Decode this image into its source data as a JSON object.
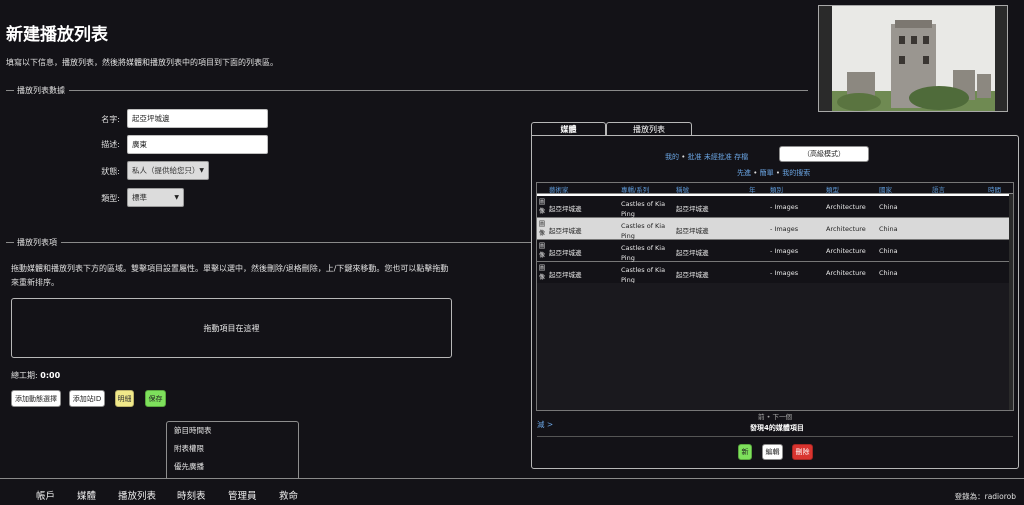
{
  "page": {
    "title": "新建播放列表",
    "intro": "填寫以下信息，播放列表，然後將媒體和播放列表中的項目到下面的列表區。"
  },
  "playlist_data": {
    "legend": "播放列表數據",
    "name_label": "名字:",
    "name_value": "起亞坪城邊",
    "desc_label": "描述:",
    "desc_value": "廣東",
    "status_label": "狀態:",
    "status_value": "私人（提供給您只）",
    "type_label": "類型:",
    "type_value": "標準"
  },
  "playlist_items": {
    "legend": "播放列表項",
    "help_text": "拖動媒體和播放列表下方的區域。雙擊項目設置屬性。單擊以選中，然後刪除/退格刪除，上/下鍵來移動。您也可以點擊拖動來重新排序。",
    "drop_zone": "拖動項目在這裡",
    "total_label": "總工期:",
    "total_value": "0:00"
  },
  "actions": {
    "add_dynamic": "添加動態選擇",
    "add_station_id": "添加站ID",
    "details": "明細",
    "save": "保存"
  },
  "dropdown_menu": [
    "節目時間表",
    "附表權限",
    "優先廣播"
  ],
  "tabs": {
    "media": "媒體",
    "playlists": "播放列表"
  },
  "media_panel": {
    "filter_mine": "我的",
    "filter_approved": "批准",
    "filter_unapproved": "未經批准",
    "filter_archive": "存檔",
    "sep": "•",
    "advanced_mode": "（高級模式）",
    "search_advanced": "先進",
    "search_simple": "簡單",
    "search_mine": "我的搜索",
    "columns": [
      "藝術家",
      "專輯/系列",
      "稱號",
      "年",
      "類別",
      "類型",
      "國家",
      "語言",
      "時間"
    ],
    "rows": [
      {
        "type": "圖像",
        "artist": "起亞坪城邊",
        "album": "Castles of Kia Ping",
        "title": "起亞坪城邊",
        "year": "",
        "category": "- Images",
        "genre": "Architecture",
        "country": "China"
      },
      {
        "type": "圖像",
        "artist": "起亞坪城邊",
        "album": "Castles of Kia Ping",
        "title": "起亞坪城邊",
        "year": "",
        "category": "- Images",
        "genre": "Architecture",
        "country": "China"
      },
      {
        "type": "圖像",
        "artist": "起亞坪城邊",
        "album": "Castles of Kia Ping",
        "title": "起亞坪城邊",
        "year": "",
        "category": "- Images",
        "genre": "Architecture",
        "country": "China"
      },
      {
        "type": "圖像",
        "artist": "起亞坪城邊",
        "album": "Castles of Kia Ping",
        "title": "起亞坪城邊",
        "year": "",
        "category": "- Images",
        "genre": "Architecture",
        "country": "China"
      }
    ],
    "pager_prev": "前",
    "pager_next": "下一個",
    "expand": "減 >",
    "found_text": "發現4的媒體項目",
    "btn_new": "新",
    "btn_edit": "編輯",
    "btn_delete": "刪除"
  },
  "nav": {
    "items": [
      "帳戶",
      "媒體",
      "播放列表",
      "時刻表",
      "管理員",
      "救命"
    ],
    "login": "登錄為：radiorob"
  },
  "colors": {
    "background": "#131217",
    "link": "#6aa4e2",
    "save_green": "#7ee05c",
    "delete_red": "#d9342f",
    "details_yellow": "#f1e98a"
  }
}
